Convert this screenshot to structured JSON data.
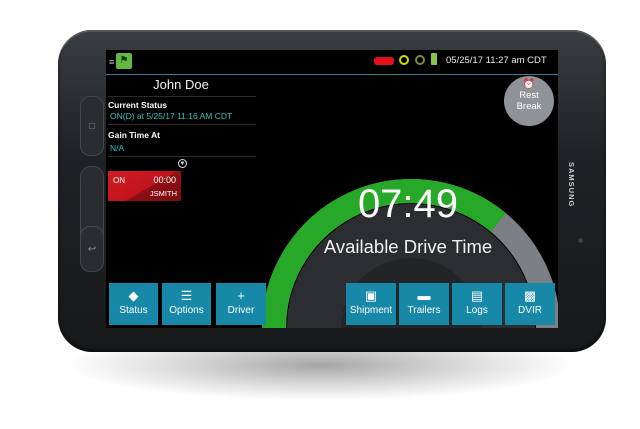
{
  "status_bar": {
    "datetime": "05/25/17 11:27 am CDT",
    "menu_icon": "hamburger-icon",
    "app_logo": "app-logo-icon",
    "indicators": [
      "red-status-indicator",
      "gps-icon",
      "wifi-icon",
      "power-plug-icon"
    ],
    "colors": {
      "red_indicator": "#e6101a",
      "accent": "#1788a8"
    }
  },
  "driver": {
    "name": "John Doe",
    "current_status_label": "Current Status",
    "current_status_value": "ON(D) at 5/25/17 11:16 AM CDT",
    "gain_time_label": "Gain Time At",
    "gain_time_value": "N/A"
  },
  "duty_card": {
    "status": "ON",
    "time": "00:00",
    "user": "JSMITH"
  },
  "gauge": {
    "time": "07:49",
    "label": "Available Drive Time",
    "arc_color": "#27a828",
    "remaining_fraction": 0.72
  },
  "rest_break": {
    "line1": "Rest",
    "line2": "Break",
    "icon": "alarm-clock-icon"
  },
  "nav": [
    {
      "label": "Status",
      "icon": "status-diamond-icon"
    },
    {
      "label": "Options",
      "icon": "options-list-icon"
    },
    {
      "label": "Driver",
      "icon": "plus-icon"
    },
    {
      "label": "Shipment",
      "icon": "shipment-box-icon"
    },
    {
      "label": "Trailers",
      "icon": "trailer-icon"
    },
    {
      "label": "Logs",
      "icon": "logs-book-icon"
    },
    {
      "label": "DVIR",
      "icon": "dvir-card-icon"
    }
  ],
  "device": {
    "brand": "SAMSUNG"
  }
}
